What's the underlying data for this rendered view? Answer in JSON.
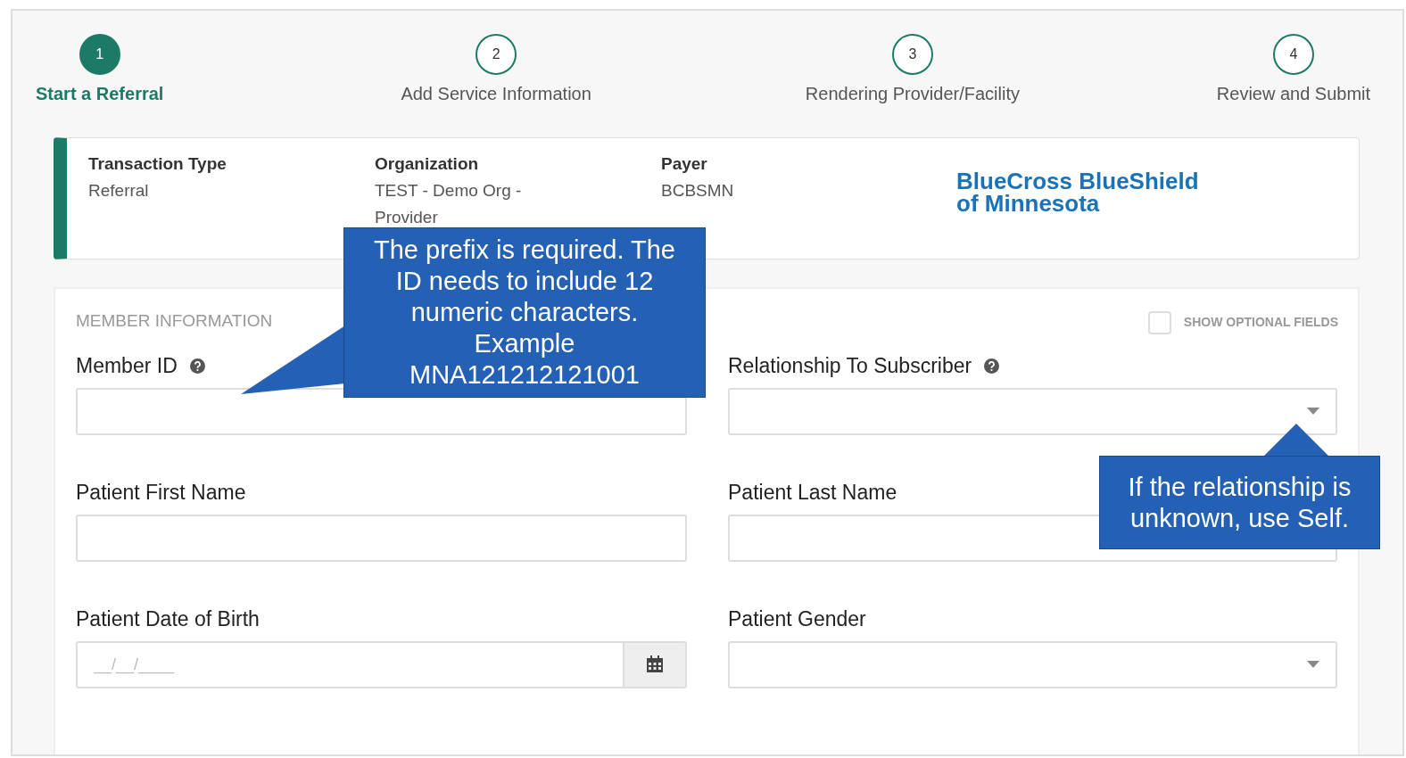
{
  "steps": [
    {
      "number": "1",
      "label": "Start a Referral",
      "selected": true
    },
    {
      "number": "2",
      "label": "Add Service Information",
      "selected": false
    },
    {
      "number": "3",
      "label": "Rendering Provider/Facility",
      "selected": false
    },
    {
      "number": "4",
      "label": "Review and Submit",
      "selected": false
    }
  ],
  "summary": [
    {
      "heading": "Transaction Type",
      "value": "Referral"
    },
    {
      "heading": "Organization",
      "value": "TEST - Demo Org - Provider"
    },
    {
      "heading": "Payer",
      "value": "BCBSMN"
    }
  ],
  "payer_logo": [
    "BlueCross BlueShield",
    "of Minnesota"
  ],
  "member_section": {
    "title": "MEMBER INFORMATION",
    "optional_toggle": {
      "label": "SHOW OPTIONAL FIELDS",
      "checked": false
    },
    "fields": [
      {
        "kind": "text",
        "label": "Member ID",
        "help": true
      },
      {
        "kind": "select",
        "label": "Relationship To Subscriber",
        "help": true
      },
      {
        "kind": "text",
        "label": "Patient First Name",
        "help": false
      },
      {
        "kind": "text",
        "label": "Patient Last Name",
        "help": false
      },
      {
        "kind": "date",
        "label": "Patient Date of Birth",
        "help": false,
        "placeholder": "__/__/____"
      },
      {
        "kind": "select",
        "label": "Patient Gender",
        "help": false
      }
    ]
  },
  "callouts": [
    {
      "text": "The prefix is required. The ID needs to include 12 numeric characters. Example MNA121212121001",
      "kind": "left"
    },
    {
      "text": "If the relationship is unknown, use Self.",
      "kind": "up"
    }
  ]
}
